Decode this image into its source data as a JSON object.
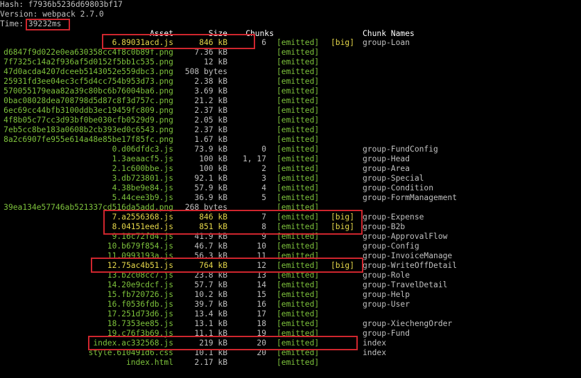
{
  "hash_line": "Hash: f7936b5236d69803bf17",
  "version_line": "Version: webpack 2.7.0",
  "time_label": "Time: ",
  "time_value": "39232",
  "time_unit": "ms",
  "headers": {
    "asset": "Asset",
    "size": "Size",
    "chunks": "Chunks",
    "chunk_names": "Chunk Names"
  },
  "emitted_label": "[emitted]",
  "big_label": "[big]",
  "rows": [
    {
      "asset": "6.89031acd.js",
      "size": "846 kB",
      "chunks": "6",
      "big": true,
      "name": "group-Loan",
      "yellow": true
    },
    {
      "asset": "d6847f9d022e0ea630358cc4f8c0b89f.png",
      "size": "7.36 kB",
      "chunks": "",
      "big": false,
      "name": ""
    },
    {
      "asset": "7f7325c14a2f936af5d0152f5bb1c535.png",
      "size": "12 kB",
      "chunks": "",
      "big": false,
      "name": ""
    },
    {
      "asset": "47d0acda4207dceeb5143052e559dbc3.png",
      "size": "508 bytes",
      "chunks": "",
      "big": false,
      "name": ""
    },
    {
      "asset": "25931fd3ee04ec3cf5d4cc754b953d73.png",
      "size": "2.38 kB",
      "chunks": "",
      "big": false,
      "name": ""
    },
    {
      "asset": "570055179eaa82a39c80bc6b76004ba6.png",
      "size": "3.69 kB",
      "chunks": "",
      "big": false,
      "name": ""
    },
    {
      "asset": "0bac08028dea708798d5d87c8f3d757c.png",
      "size": "21.2 kB",
      "chunks": "",
      "big": false,
      "name": ""
    },
    {
      "asset": "6ec69cc44bfb3100ddb3ec19459fc809.png",
      "size": "2.37 kB",
      "chunks": "",
      "big": false,
      "name": ""
    },
    {
      "asset": "4f8b05c77cc3d93bf0be030cfb0529d9.png",
      "size": "2.05 kB",
      "chunks": "",
      "big": false,
      "name": ""
    },
    {
      "asset": "7eb5cc8be183a0608b2cb393ed0c6543.png",
      "size": "2.37 kB",
      "chunks": "",
      "big": false,
      "name": ""
    },
    {
      "asset": "8a2c6907fe955e614a48e85be17f85fc.png",
      "size": "1.67 kB",
      "chunks": "",
      "big": false,
      "name": ""
    },
    {
      "asset": "0.d06dfdc3.js",
      "size": "73.9 kB",
      "chunks": "0",
      "big": false,
      "name": "group-FundConfig"
    },
    {
      "asset": "1.3aeaacf5.js",
      "size": "100 kB",
      "chunks": "1, 17",
      "big": false,
      "name": "group-Head"
    },
    {
      "asset": "2.1c600bbe.js",
      "size": "100 kB",
      "chunks": "2",
      "big": false,
      "name": "group-Area"
    },
    {
      "asset": "3.db723801.js",
      "size": "92.1 kB",
      "chunks": "3",
      "big": false,
      "name": "group-Special"
    },
    {
      "asset": "4.38be9e84.js",
      "size": "57.9 kB",
      "chunks": "4",
      "big": false,
      "name": "group-Condition"
    },
    {
      "asset": "5.44cee3b9.js",
      "size": "36.9 kB",
      "chunks": "5",
      "big": false,
      "name": "group-FormManagement"
    },
    {
      "asset": "39ea134e57746ab521337cd516da5add.png",
      "size": "268 bytes",
      "chunks": "",
      "big": false,
      "name": ""
    },
    {
      "asset": "7.a2556368.js",
      "size": "846 kB",
      "chunks": "7",
      "big": true,
      "name": "group-Expense",
      "yellow": true
    },
    {
      "asset": "8.04151eed.js",
      "size": "851 kB",
      "chunks": "8",
      "big": true,
      "name": "group-B2b",
      "yellow": true
    },
    {
      "asset": "9.16c72fd4.js",
      "size": "41.9 kB",
      "chunks": "9",
      "big": false,
      "name": "group-ApprovalFlow"
    },
    {
      "asset": "10.b679f854.js",
      "size": "46.7 kB",
      "chunks": "10",
      "big": false,
      "name": "group-Config"
    },
    {
      "asset": "11.0993193a.js",
      "size": "56.3 kB",
      "chunks": "11",
      "big": false,
      "name": "group-InvoiceManage"
    },
    {
      "asset": "12.75ac4b51.js",
      "size": "764 kB",
      "chunks": "12",
      "big": true,
      "name": "group-WriteOffDetail",
      "yellow": true
    },
    {
      "asset": "13.b2c08cc7.js",
      "size": "23.8 kB",
      "chunks": "13",
      "big": false,
      "name": "group-Role"
    },
    {
      "asset": "14.20e9cdcf.js",
      "size": "57.7 kB",
      "chunks": "14",
      "big": false,
      "name": "group-TravelDetail"
    },
    {
      "asset": "15.fb720726.js",
      "size": "10.2 kB",
      "chunks": "15",
      "big": false,
      "name": "group-Help"
    },
    {
      "asset": "16.f0536fdb.js",
      "size": "39.7 kB",
      "chunks": "16",
      "big": false,
      "name": "group-User"
    },
    {
      "asset": "17.251d73d6.js",
      "size": "13.4 kB",
      "chunks": "17",
      "big": false,
      "name": ""
    },
    {
      "asset": "18.7353ee85.js",
      "size": "13.1 kB",
      "chunks": "18",
      "big": false,
      "name": "group-XiechengOrder"
    },
    {
      "asset": "19.c76f3b69.js",
      "size": "11.1 kB",
      "chunks": "19",
      "big": false,
      "name": "group-Fund"
    },
    {
      "asset": "index.ac332568.js",
      "size": "219 kB",
      "chunks": "20",
      "big": false,
      "name": "index"
    },
    {
      "asset": "style.610491d6.css",
      "size": "10.1 kB",
      "chunks": "20",
      "big": false,
      "name": "index"
    },
    {
      "asset": "index.html",
      "size": "2.17 kB",
      "chunks": "",
      "big": false,
      "name": ""
    }
  ],
  "colors": {
    "background": "#000000",
    "text": "#c0c0c0",
    "green": "#7ec33c",
    "yellow": "#e6d84a",
    "annotation_red": "#d0262e"
  }
}
